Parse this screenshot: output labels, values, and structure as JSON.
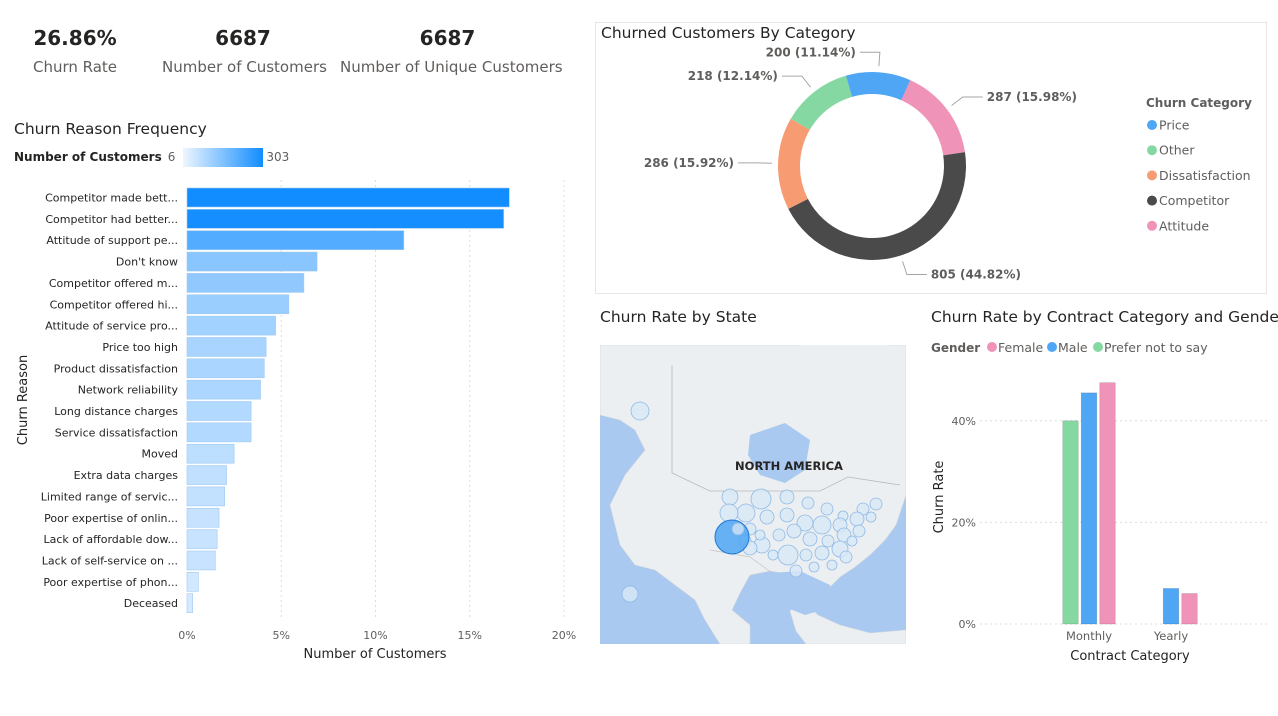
{
  "kpis": [
    {
      "value": "26.86%",
      "label": "Churn Rate"
    },
    {
      "value": "6687",
      "label": "Number of Customers"
    },
    {
      "value": "6687",
      "label": "Number of Unique Customers"
    }
  ],
  "colors": {
    "bar_dark": "#118dff",
    "bar_light": "#d6eaff",
    "price": "#4ea6f5",
    "other": "#86d8a3",
    "dissatisfaction": "#f79b73",
    "competitor": "#4a4a4a",
    "attitude": "#ef93b8",
    "map_water": "#a9c9f0",
    "map_land": "#eceff1"
  },
  "chart_data": [
    {
      "type": "bar",
      "title": "Churn Reason Frequency",
      "xlabel": "Number of Customers",
      "ylabel": "Churn Reason",
      "legend": {
        "title": "Number of Customers",
        "min_label": "6",
        "max_label": "303"
      },
      "categories": [
        "Competitor made bett...",
        "Competitor had better...",
        "Attitude of support pe...",
        "Don't know",
        "Competitor offered m...",
        "Competitor offered hi...",
        "Attitude of service pro...",
        "Price too high",
        "Product dissatisfaction",
        "Network reliability",
        "Long distance charges",
        "Service dissatisfaction",
        "Moved",
        "Extra data charges",
        "Limited range of servic...",
        "Poor expertise of onlin...",
        "Lack of affordable dow...",
        "Lack of self-service on ...",
        "Poor expertise of phon...",
        "Deceased"
      ],
      "values": [
        17.1,
        16.8,
        11.5,
        6.9,
        6.2,
        5.4,
        4.7,
        4.2,
        4.1,
        3.9,
        3.4,
        3.4,
        2.5,
        2.1,
        2.0,
        1.7,
        1.6,
        1.5,
        0.6,
        0.3
      ],
      "xticks": [
        "0%",
        "5%",
        "10%",
        "15%",
        "20%"
      ],
      "xlim": [
        0,
        20
      ]
    },
    {
      "type": "pie",
      "title": "Churned Customers By Category",
      "legend_title": "Churn Category",
      "slices": [
        {
          "name": "Price",
          "value": 200,
          "label": "200 (11.14%)",
          "color": "#4ea6f5"
        },
        {
          "name": "Other",
          "value": 218,
          "label": "218 (12.14%)",
          "color": "#86d8a3"
        },
        {
          "name": "Dissatisfaction",
          "value": 286,
          "label": "286 (15.92%)",
          "color": "#f79b73"
        },
        {
          "name": "Competitor",
          "value": 805,
          "label": "805 (44.82%)",
          "color": "#4a4a4a"
        },
        {
          "name": "Attitude",
          "value": 287,
          "label": "287 (15.98%)",
          "color": "#ef93b8"
        }
      ],
      "legend_order": [
        "Price",
        "Other",
        "Dissatisfaction",
        "Competitor",
        "Attitude"
      ]
    },
    {
      "type": "map",
      "title": "Churn Rate by State",
      "region_label": "NORTH AMERICA"
    },
    {
      "type": "bar",
      "title": "Churn Rate by Contract Category and Gender",
      "xlabel": "Contract Category",
      "ylabel": "Churn Rate",
      "legend_title": "Gender",
      "categories": [
        "Monthly",
        "Yearly"
      ],
      "series": [
        {
          "name": "Prefer not to say",
          "color": "#86d8a3",
          "values": [
            40,
            null
          ]
        },
        {
          "name": "Male",
          "color": "#4ea6f5",
          "values": [
            45.5,
            7
          ]
        },
        {
          "name": "Female",
          "color": "#ef93b8",
          "values": [
            47.5,
            6
          ]
        }
      ],
      "legend_order": [
        "Female",
        "Male",
        "Prefer not to say"
      ],
      "yticks": [
        "0%",
        "20%",
        "40%"
      ],
      "ylim": [
        0,
        50
      ]
    }
  ]
}
